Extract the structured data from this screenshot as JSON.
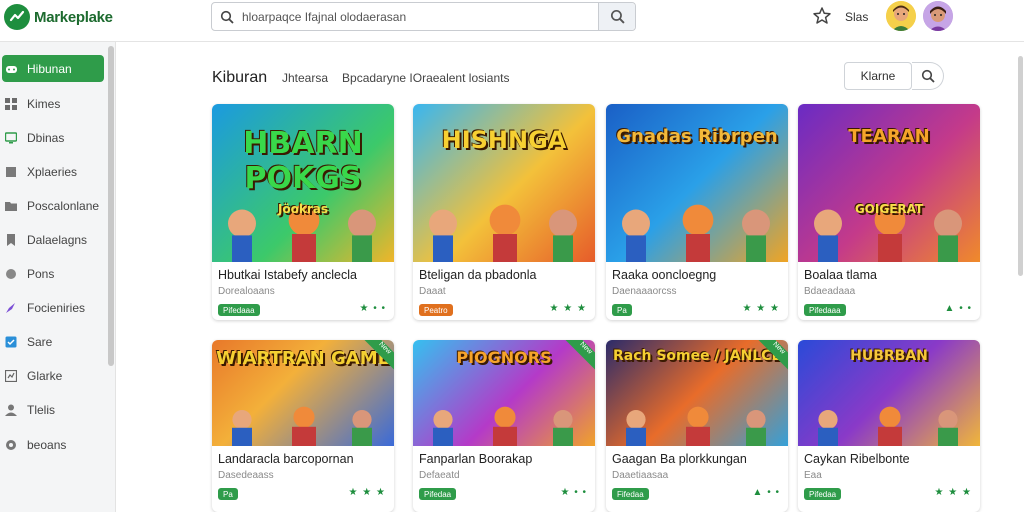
{
  "app": {
    "logo_text": "Markeplake"
  },
  "search": {
    "value": "hloarpaqce Ifajnal olodaerasan",
    "placeholder": ""
  },
  "header": {
    "label": "Slas"
  },
  "sidebar": {
    "items": [
      {
        "label": "Hibunan",
        "icon": "controller-icon",
        "active": true
      },
      {
        "label": "Kimes",
        "icon": "grid-icon"
      },
      {
        "label": "Dbinas",
        "icon": "monitor-icon"
      },
      {
        "label": "Xplaeries",
        "icon": "box-icon"
      },
      {
        "label": "Poscalonlane",
        "icon": "folder-icon"
      },
      {
        "label": "Dalaelagns",
        "icon": "bookmark-icon"
      },
      {
        "label": "Pons",
        "icon": "puzzle-icon"
      },
      {
        "label": "Focieniries",
        "icon": "rocket-icon"
      },
      {
        "label": "Sare",
        "icon": "checkbox-icon"
      },
      {
        "label": "Glarke",
        "icon": "chart-icon"
      },
      {
        "label": "Tlelis",
        "icon": "person-icon"
      },
      {
        "label": "beoans",
        "icon": "gear-icon"
      }
    ]
  },
  "main": {
    "title": "Kiburan",
    "tabs": [
      "Jhtearsa",
      "Bpcadaryne IOraealent losiants"
    ],
    "sort_label": "Klarne"
  },
  "cards": [
    {
      "thumb_text": "HBARN POKGS",
      "thumb_sub": "Jöokras",
      "title": "Hbutkai Istabefy anclecla",
      "sub": "Dorealoaans",
      "badge": "Pifedaaa",
      "badge_color": "#2f9c4a",
      "rating": "★ • •"
    },
    {
      "thumb_text": "HISHNGA",
      "thumb_sub": "",
      "title": "Bteligan da pbadonla",
      "sub": "Daaat",
      "badge": "Peatro",
      "badge_color": "#e0701e",
      "rating": "★ ★ ★"
    },
    {
      "thumb_text": "Gnadas Ribrpen",
      "thumb_sub": "",
      "title": "Raaka ooncloegng",
      "sub": "Daenaaaorcss",
      "badge": "Pa",
      "badge_color": "#2f9c4a",
      "rating": "★ ★ ★"
    },
    {
      "thumb_text": "TEARAN",
      "thumb_sub": "GOIGERAT",
      "title": "Boalaa tlama",
      "sub": "Bdaeadaaa",
      "badge": "Pifedaaa",
      "badge_color": "#2f9c4a",
      "rating": "▲ • •"
    },
    {
      "thumb_text": "WIARTRAN GAME",
      "thumb_sub": "",
      "title": "Landaracla barcopornan",
      "sub": "Dasedeaass",
      "badge": "Pa",
      "badge_color": "#2f9c4a",
      "rating": "★ ★ ★"
    },
    {
      "thumb_text": "PIOGNORS",
      "thumb_sub": "",
      "title": "Fanparlan Boorakap",
      "sub": "Defaeatd",
      "badge": "Pifedaa",
      "badge_color": "#2f9c4a",
      "rating": "★ • •"
    },
    {
      "thumb_text": "Rach Somee / JANLCE",
      "thumb_sub": "",
      "title": "Gaagan Ba plorkkungan",
      "sub": "Daaetiaasaa",
      "badge": "Fifedaa",
      "badge_color": "#2f9c4a",
      "rating": "▲ • •"
    },
    {
      "thumb_text": "HUBRBAN",
      "thumb_sub": "",
      "title": "Caykan Ribelbonte",
      "sub": "Eaa",
      "badge": "Pifedaa",
      "badge_color": "#2f9c4a",
      "rating": "★ ★ ★"
    }
  ],
  "corner_tag": "New"
}
